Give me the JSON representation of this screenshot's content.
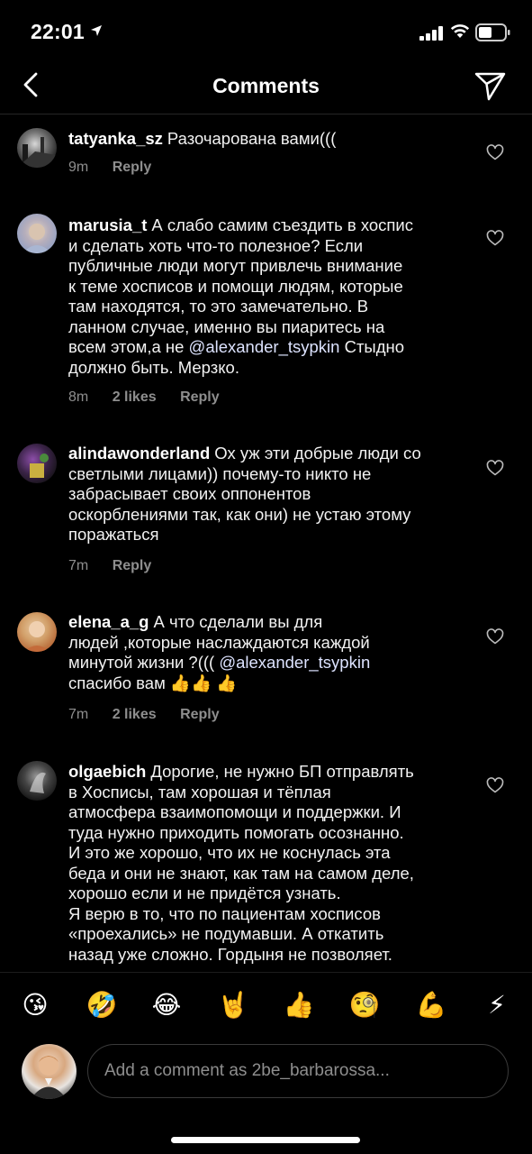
{
  "status": {
    "time": "22:01"
  },
  "header": {
    "title": "Comments"
  },
  "comments": [
    {
      "username": "tatyanka_sz",
      "text": "Разочарована вами(((",
      "lines": [],
      "time": "9m",
      "likes": "",
      "reply": "Reply"
    },
    {
      "username": "marusia_t",
      "text": "А слабо самим съездить в хоспис",
      "lines": [
        "и сделать хоть что-то полезное? Если",
        "публичные люди могут привлечь внимание",
        "к теме хосписов и помощи людям, которые",
        "там находятся, то это замечательно. В",
        "ланном случае, именно вы пиаритесь на",
        "всем этом,а не  @alexander_tsypkin Стыдно",
        "должно быть. Мерзко."
      ],
      "time": "8m",
      "likes": "2 likes",
      "reply": "Reply"
    },
    {
      "username": "alindawonderland",
      "text": "Ох уж эти добрые люди со",
      "lines": [
        "светлыми лицами)) почему-то никто не",
        "забрасывает своих оппонентов",
        "оскорблениями так, как они) не устаю этому",
        "поражаться"
      ],
      "time": "7m",
      "likes": "",
      "reply": "Reply"
    },
    {
      "username": "elena_a_g",
      "text": "А что сделали вы для",
      "lines": [
        "людей ,которые наслаждаются  каждой",
        "минутой жизни ?((( @alexander_tsypkin",
        "спасибо вам 👍👍 👍"
      ],
      "time": "7m",
      "likes": "2 likes",
      "reply": "Reply"
    },
    {
      "username": "olgaebich",
      "text": "Дорогие, не нужно БП отправлять",
      "lines": [
        "в Хосписы, там хорошая и тёплая",
        "атмосфера взаимопомощи и поддержки. И",
        "туда нужно приходить помогать осознанно.",
        "И это же хорошо, что их не коснулась эта",
        "беда и они не знают, как там на самом деле,",
        "хорошо если и не придётся узнать.",
        "Я верю в то, что по пациентам хосписов",
        "«проехались» не подумавши. А откатить",
        "назад уже сложно. Гордыня не позволяет."
      ],
      "time": "",
      "likes": "",
      "reply": ""
    }
  ],
  "emojis": [
    {
      "glyph": "😘",
      "name": "kiss"
    },
    {
      "glyph": "🤣",
      "name": "rofl"
    },
    {
      "glyph": "😂",
      "name": "joy"
    },
    {
      "glyph": "🤘",
      "name": "rock"
    },
    {
      "glyph": "👍",
      "name": "thumbs-up"
    },
    {
      "glyph": "🧐",
      "name": "monocle"
    },
    {
      "glyph": "💪",
      "name": "muscle"
    },
    {
      "glyph": "⚡",
      "name": "lightning"
    }
  ],
  "composer": {
    "placeholder": "Add a comment as 2be_barbarossa..."
  },
  "colors": {
    "background": "#000000",
    "secondary_text": "#8e8e8e",
    "mention": "#dde3ff"
  }
}
